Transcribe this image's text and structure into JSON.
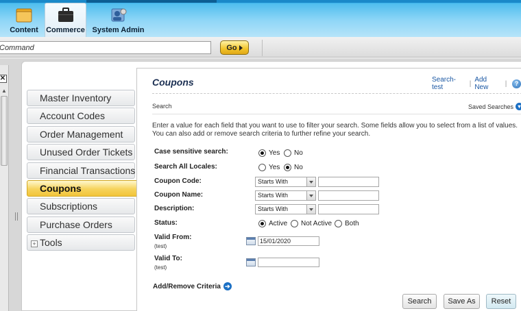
{
  "app_tabs": [
    {
      "label": "Content",
      "icon": "folder-icon"
    },
    {
      "label": "Commerce",
      "icon": "briefcase-icon",
      "active": true
    },
    {
      "label": "System Admin",
      "icon": "system-admin-icon"
    }
  ],
  "command": {
    "placeholder": "Command",
    "go_label": "Go"
  },
  "close_glyph": "✕",
  "menu": [
    {
      "label": "Master Inventory"
    },
    {
      "label": "Account Codes"
    },
    {
      "label": "Order Management"
    },
    {
      "label": "Unused Order Tickets"
    },
    {
      "label": "Financial Transactions"
    },
    {
      "label": "Coupons",
      "active": true
    },
    {
      "label": "Subscriptions"
    },
    {
      "label": "Purchase Orders"
    },
    {
      "label": "Tools",
      "expandable": true
    }
  ],
  "page": {
    "title": "Coupons",
    "links": {
      "search_test": "Search-test",
      "add_new": "Add New",
      "help": "?"
    },
    "search_label": "Search",
    "saved_searches": "Saved Searches",
    "intro": "Enter a value for each field that you want to use to filter your search. Some fields allow you to select from a list of values. You can also add or remove search criteria to further refine your search."
  },
  "form": {
    "case_sensitive": {
      "label": "Case sensitive search:",
      "options": [
        "Yes",
        "No"
      ],
      "selected": "Yes"
    },
    "all_locales": {
      "label": "Search All Locales:",
      "options": [
        "Yes",
        "No"
      ],
      "selected": "No"
    },
    "coupon_code": {
      "label": "Coupon Code:",
      "operator": "Starts With",
      "value": ""
    },
    "coupon_name": {
      "label": "Coupon Name:",
      "operator": "Starts With",
      "value": ""
    },
    "description": {
      "label": "Description:",
      "operator": "Starts With",
      "value": ""
    },
    "status": {
      "label": "Status:",
      "options": [
        "Active",
        "Not Active",
        "Both"
      ],
      "selected": "Active"
    },
    "valid_from": {
      "label": "Valid From:",
      "sub": "(test)",
      "value": "15/01/2020"
    },
    "valid_to": {
      "label": "Valid To:",
      "sub": "(test)",
      "value": ""
    },
    "add_remove": "Add/Remove Criteria"
  },
  "buttons": {
    "search": "Search",
    "save_as": "Save As",
    "reset": "Reset"
  }
}
